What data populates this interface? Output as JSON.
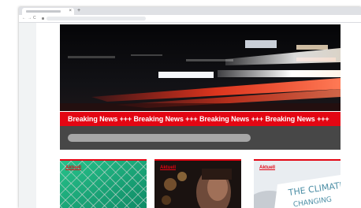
{
  "ticker": {
    "text": "Breaking News +++ Breaking News +++ Breaking News +++ Breaking News +++"
  },
  "cards": [
    {
      "label": "Aktuell"
    },
    {
      "label": "Aktuell"
    },
    {
      "label": "Aktuell"
    }
  ],
  "colors": {
    "accent": "#e30613",
    "search_area": "#474747",
    "search_bar": "#a6a6a6"
  },
  "icons": {
    "tab_close": "×",
    "new_tab": "+",
    "back": "←",
    "forward": "→",
    "reload": "C"
  }
}
